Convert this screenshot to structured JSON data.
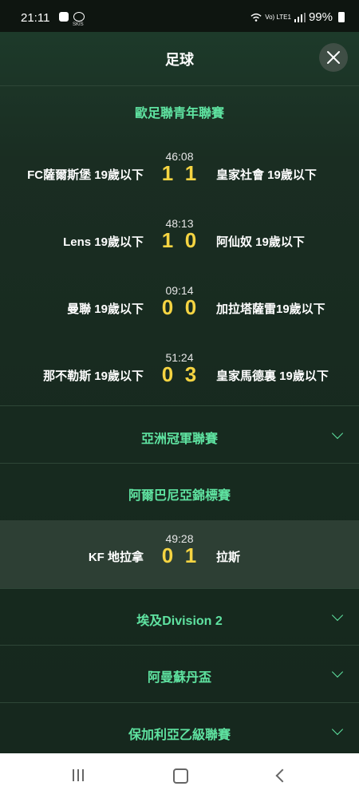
{
  "status_bar": {
    "time": "21:11",
    "app_label": "SKIS",
    "network": "Vo) LTE1",
    "battery": "99%"
  },
  "header": {
    "title": "足球"
  },
  "sections": [
    {
      "name": "歐足聯青年聯賽",
      "expanded": true
    },
    {
      "name": "亞洲冠軍聯賽",
      "expanded": false
    },
    {
      "name": "阿爾巴尼亞錦標賽",
      "expanded": true
    },
    {
      "name": "埃及Division 2",
      "expanded": false
    },
    {
      "name": "阿曼蘇丹盃",
      "expanded": false
    },
    {
      "name": "保加利亞乙級聯賽",
      "expanded": false
    }
  ],
  "matches": [
    {
      "clock": "46:08",
      "home": "FC薩爾斯堡 19歲以下",
      "home_score": "1",
      "away_score": "1",
      "away": "皇家社會 19歲以下"
    },
    {
      "clock": "48:13",
      "home": "Lens 19歲以下",
      "home_score": "1",
      "away_score": "0",
      "away": "阿仙奴 19歲以下"
    },
    {
      "clock": "09:14",
      "home": "曼聯 19歲以下",
      "home_score": "0",
      "away_score": "0",
      "away": "加拉塔薩雷19歲以下"
    },
    {
      "clock": "51:24",
      "home": "那不勒斯 19歲以下",
      "home_score": "0",
      "away_score": "3",
      "away": "皇家馬德裏 19歲以下"
    },
    {
      "clock": "49:28",
      "home": "KF 地拉拿",
      "home_score": "0",
      "away_score": "1",
      "away": "拉斯"
    }
  ],
  "colors": {
    "accent": "#5fe3a1",
    "score": "#f5d442",
    "background": "#172a1f"
  },
  "icons": {
    "close": "close-icon",
    "chevron": "chevron-down-icon"
  }
}
